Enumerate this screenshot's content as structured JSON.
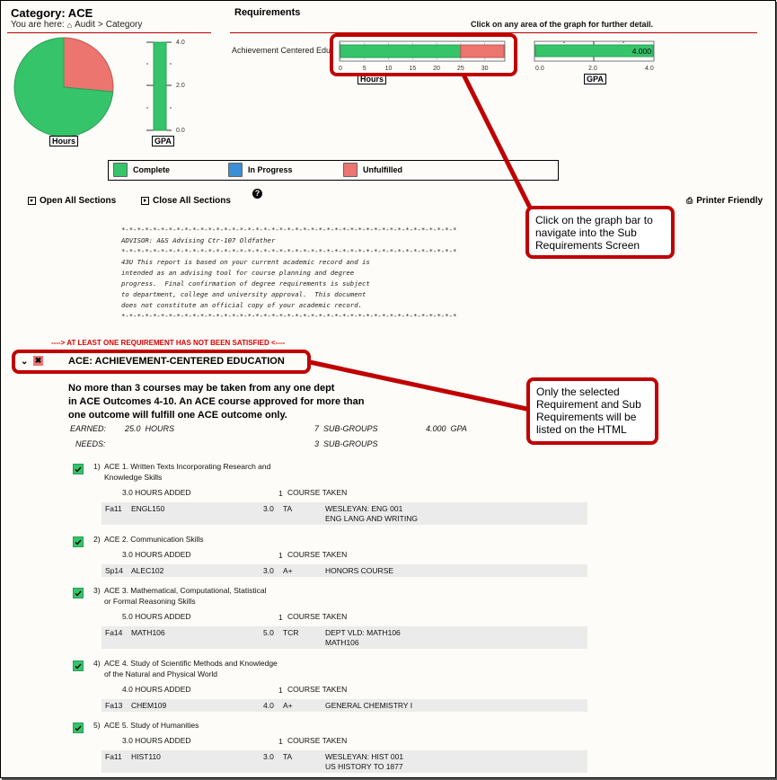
{
  "header": {
    "title": "Category: ACE",
    "breadcrumb_prefix": "You are here:",
    "breadcrumb_home": "Audit",
    "breadcrumb_sep": ">",
    "breadcrumb_current": "Category"
  },
  "summary_charts": {
    "hours_label": "Hours",
    "gpa_label": "GPA",
    "gpa_ticks": [
      "4.0",
      "2.0",
      "0.0"
    ]
  },
  "requirements": {
    "title": "Requirements",
    "hint": "Click on any area of the graph for further detail.",
    "row_label": "Achievement Centered Edu",
    "hours_axis_label": "Hours",
    "hours_ticks": [
      "0",
      "5",
      "10",
      "15",
      "20",
      "25",
      "30"
    ],
    "gpa_axis_label": "GPA",
    "gpa_ticks": [
      "0.0",
      "2.0",
      "4.0"
    ],
    "gpa_value_text": "4.000"
  },
  "chart_data": [
    {
      "type": "pie",
      "title": "Hours",
      "slices": [
        {
          "label": "Complete",
          "value": 25,
          "color": "#35c46a"
        },
        {
          "label": "Unfulfilled",
          "value": 9,
          "color": "#ec7570"
        }
      ]
    },
    {
      "type": "bar",
      "title": "GPA",
      "orientation": "vertical",
      "categories": [
        "ACE"
      ],
      "values": [
        4.0
      ],
      "ylim": [
        0,
        4.0
      ],
      "yticks": [
        "0.0",
        "2.0",
        "4.0"
      ]
    },
    {
      "type": "bar",
      "title": "Hours",
      "orientation": "horizontal-stacked",
      "categories": [
        "Achievement Centered Edu"
      ],
      "series": [
        {
          "name": "Complete",
          "values": [
            25
          ]
        },
        {
          "name": "Unfulfilled",
          "values": [
            9
          ]
        }
      ],
      "xlim": [
        0,
        34
      ],
      "xticks": [
        "0",
        "5",
        "10",
        "15",
        "20",
        "25",
        "30"
      ]
    },
    {
      "type": "bar",
      "title": "GPA",
      "orientation": "horizontal",
      "categories": [
        "Achievement Centered Edu"
      ],
      "values": [
        4.0
      ],
      "xlim": [
        0,
        4.0
      ],
      "xticks": [
        "0.0",
        "2.0",
        "4.0"
      ],
      "data_label": "4.000"
    }
  ],
  "legend": [
    {
      "label": "Complete",
      "color": "#35c46a"
    },
    {
      "label": "In Progress",
      "color": "#3a8fd6"
    },
    {
      "label": "Unfulfilled",
      "color": "#ec7570"
    }
  ],
  "actions": {
    "open_all": "Open All Sections",
    "close_all": "Close All Sections",
    "help_icon": "?",
    "printer_friendly": "Printer Friendly"
  },
  "advisor_block": [
    "*-*-*-*-*-*-*-*-*-*-*-*-*-*-*-*-*-*-*-*-*-*-*-*-*-*-*-*-*-*-*-*-*-*-*-*-*-*-*-*-*-*-*",
    "ADVISOR: A&S Advising Ctr-107 Oldfather",
    "*-*-*-*-*-*-*-*-*-*-*-*-*-*-*-*-*-*-*-*-*-*-*-*-*-*-*-*-*-*-*-*-*-*-*-*-*-*-*-*-*-*-*",
    "43U This report is based on your current academic record and is",
    "intended as an advising tool for course planning and degree",
    "progress.  Final confirmation of degree requirements is subject",
    "to department, college and university approval.  This document",
    "does not constitute an official copy of your academic record.",
    "*-*-*-*-*-*-*-*-*-*-*-*-*-*-*-*-*-*-*-*-*-*-*-*-*-*-*-*-*-*-*-*-*-*-*-*-*-*-*-*-*-*-*"
  ],
  "warning": "----> AT LEAST ONE REQUIREMENT HAS NOT BEEN SATISFIED <----",
  "requirement": {
    "title": "ACE: ACHIEVEMENT-CENTERED EDUCATION",
    "status": "unfulfilled",
    "description": [
      "No more than 3 courses may be taken from any one dept",
      "in ACE Outcomes 4-10. An ACE course approved for more than",
      "one outcome will fulfill one ACE outcome only."
    ],
    "earned_label": "EARNED:",
    "earned_hours": "25.0  HOURS",
    "earned_subgroups": "7  SUB-GROUPS",
    "earned_gpa": "4.000  GPA",
    "needs_label": "NEEDS:",
    "needs_subgroups": "3  SUB-GROUPS"
  },
  "sub_requirements": [
    {
      "num": "1)",
      "title_lines": [
        "ACE 1. Written Texts Incorporating Research and",
        "Knowledge Skills"
      ],
      "hours_added": "3.0 HOURS ADDED",
      "course_count": "1",
      "course_label": "COURSE TAKEN",
      "course": {
        "term": "Fa11",
        "id": "ENGL150",
        "credits": "3.0",
        "grade": "TA",
        "desc_lines": [
          "WESLEYAN: ENG 001",
          "ENG LANG AND WRITING"
        ]
      }
    },
    {
      "num": "2)",
      "title_lines": [
        "ACE 2. Communication Skills"
      ],
      "hours_added": "3.0 HOURS ADDED",
      "course_count": "1",
      "course_label": "COURSE TAKEN",
      "course": {
        "term": "Sp14",
        "id": "ALEC102",
        "credits": "3.0",
        "grade": "A+",
        "desc_lines": [
          "HONORS COURSE"
        ]
      }
    },
    {
      "num": "3)",
      "title_lines": [
        "ACE 3. Mathematical, Computational, Statistical",
        "or Formal Reasoning Skills"
      ],
      "hours_added": "5.0 HOURS ADDED",
      "course_count": "1",
      "course_label": "COURSE TAKEN",
      "course": {
        "term": "Fa14",
        "id": "MATH106",
        "credits": "5.0",
        "grade": "TCR",
        "desc_lines": [
          "DEPT VLD: MATH106",
          "MATH106"
        ]
      }
    },
    {
      "num": "4)",
      "title_lines": [
        "ACE 4. Study of Scientific Methods and Knowledge",
        "of the Natural and Physical World"
      ],
      "hours_added": "4.0 HOURS ADDED",
      "course_count": "1",
      "course_label": "COURSE TAKEN",
      "course": {
        "term": "Fa13",
        "id": "CHEM109",
        "credits": "4.0",
        "grade": "A+",
        "desc_lines": [
          "GENERAL CHEMISTRY I"
        ]
      }
    },
    {
      "num": "5)",
      "title_lines": [
        "ACE 5. Study of Humanities"
      ],
      "hours_added": "3.0 HOURS ADDED",
      "course_count": "1",
      "course_label": "COURSE TAKEN",
      "course": {
        "term": "Fa11",
        "id": "HIST110",
        "credits": "3.0",
        "grade": "TA",
        "desc_lines": [
          "WESLEYAN: HIST 001",
          "US HISTORY TO 1877"
        ]
      }
    }
  ],
  "callouts": {
    "graph_bar": "Click on the graph bar to navigate into the Sub Requirements Screen",
    "selected_req": "Only the selected Requirement and Sub Requirements will be listed on the HTML"
  },
  "colors": {
    "complete": "#35c46a",
    "in_progress": "#3a8fd6",
    "unfulfilled": "#ec7570",
    "accent_red": "#c00000"
  }
}
